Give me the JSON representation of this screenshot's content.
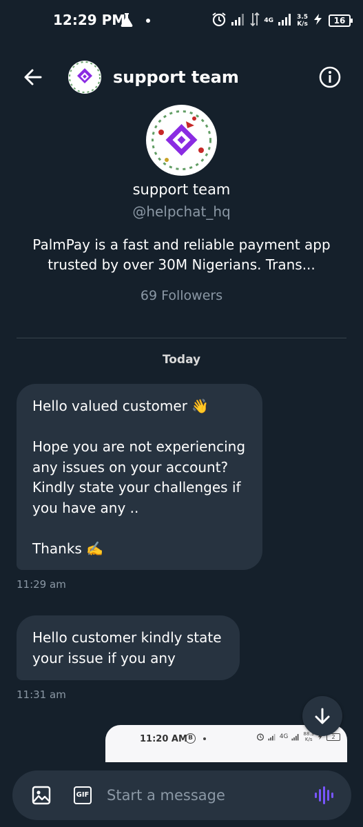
{
  "status_bar": {
    "time": "12:29 PM",
    "net_type": "4G",
    "speed_value": "3.5",
    "speed_unit": "K/s",
    "battery": "16"
  },
  "header": {
    "title": "support team"
  },
  "profile": {
    "name": "support team",
    "handle": "@helpchat_hq",
    "bio": "PalmPay is a fast and reliable payment app trusted by over 30M Nigerians. Trans...",
    "followers": "69 Followers"
  },
  "conversation": {
    "day_label": "Today",
    "messages": [
      {
        "text": "Hello valued customer 👋\n\nHope you are not experiencing any issues on your account? Kindly state your challenges if you have any ..\n\nThanks ✍️",
        "time": "11:29 am"
      },
      {
        "text": "Hello customer kindly state your issue if you any",
        "time": "11:31 am"
      }
    ],
    "image_preview": {
      "time": "11:20 AM",
      "b_label": "B",
      "net_type": "4G",
      "speed_value": "88.3",
      "speed_unit": "K/s",
      "battery": "2"
    }
  },
  "composer": {
    "gif_label": "GIF",
    "placeholder": "Start a message"
  },
  "colors": {
    "background": "#15202b",
    "bubble": "#273340",
    "muted_text": "#8b98a5",
    "accent_voice": "#7856ff",
    "brand_purple": "#8a2be2"
  }
}
